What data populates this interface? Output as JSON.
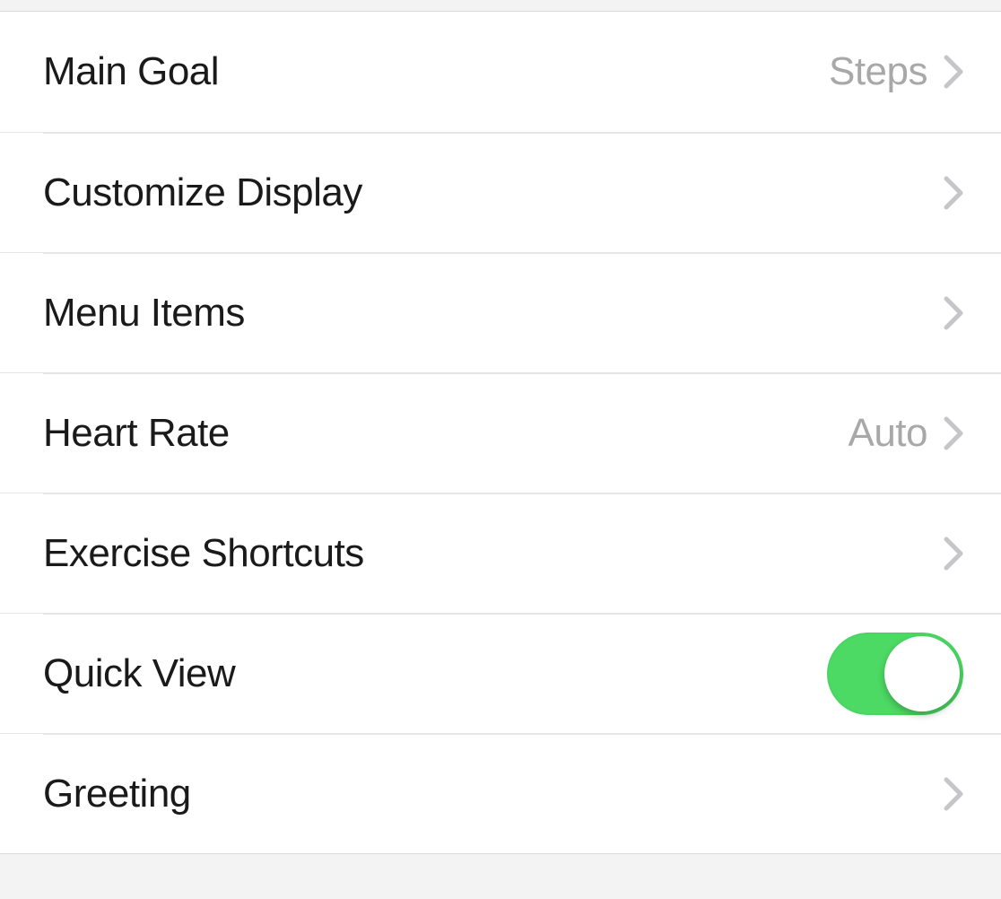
{
  "rows": [
    {
      "id": "main-goal",
      "label": "Main Goal",
      "value": "Steps",
      "type": "nav"
    },
    {
      "id": "customize-display",
      "label": "Customize Display",
      "value": "",
      "type": "nav"
    },
    {
      "id": "menu-items",
      "label": "Menu Items",
      "value": "",
      "type": "nav"
    },
    {
      "id": "heart-rate",
      "label": "Heart Rate",
      "value": "Auto",
      "type": "nav"
    },
    {
      "id": "exercise-shortcuts",
      "label": "Exercise Shortcuts",
      "value": "",
      "type": "nav"
    },
    {
      "id": "quick-view",
      "label": "Quick View",
      "on": true,
      "type": "toggle"
    },
    {
      "id": "greeting",
      "label": "Greeting",
      "value": "",
      "type": "nav"
    }
  ],
  "colors": {
    "toggle_on": "#4cd964",
    "chevron": "#c6c6c9",
    "value_text": "#a8a8a8",
    "label_text": "#1a1a1a"
  }
}
